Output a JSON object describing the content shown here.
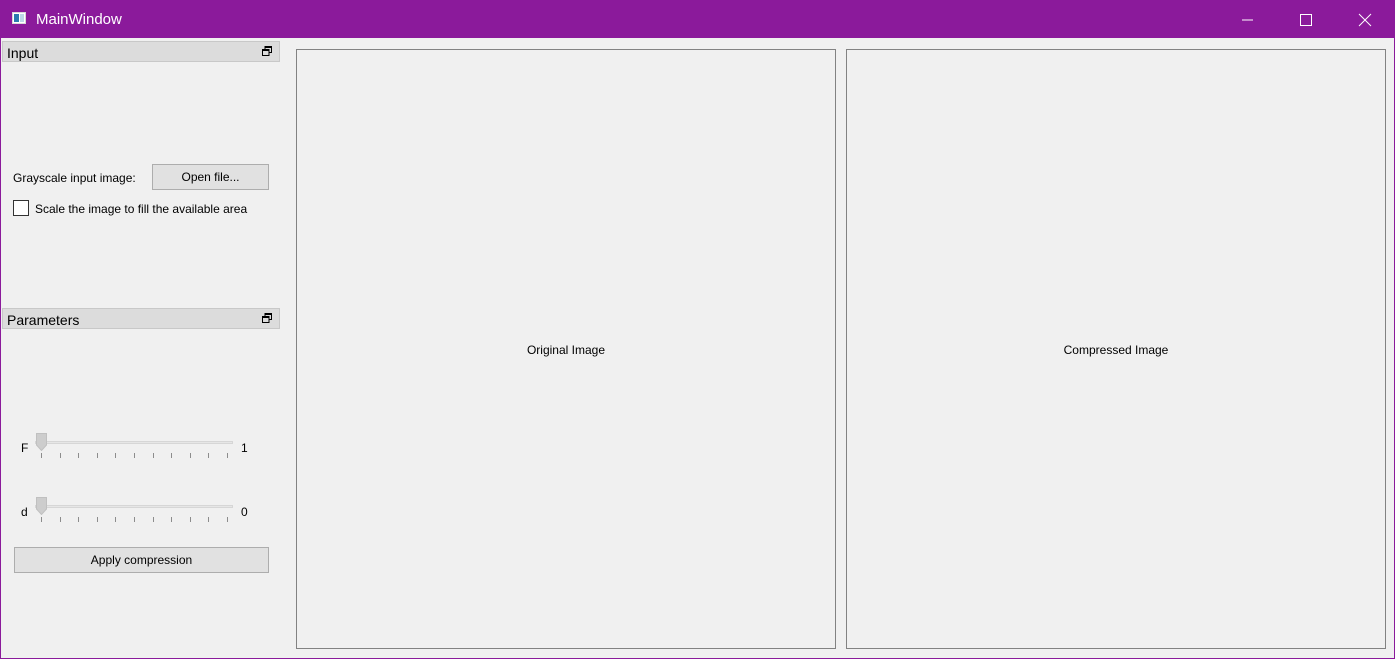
{
  "window": {
    "title": "MainWindow",
    "accent_color": "#8b1a9b",
    "icons": {
      "app": "app-window-icon",
      "minimize": "minimize-icon",
      "maximize": "maximize-icon",
      "close": "close-icon"
    }
  },
  "input_dock": {
    "title": "Input",
    "float_icon": "float-dock-icon",
    "image_label": "Grayscale input image:",
    "open_button": "Open file...",
    "scale_checkbox": {
      "label": "Scale the image to fill the available area",
      "checked": false
    }
  },
  "parameters_dock": {
    "title": "Parameters",
    "float_icon": "float-dock-icon",
    "sliders": [
      {
        "name": "F",
        "value": "1",
        "position": 0.0,
        "tick_count": 11
      },
      {
        "name": "d",
        "value": "0",
        "position": 0.0,
        "tick_count": 11
      }
    ],
    "apply_button": "Apply compression"
  },
  "panels": {
    "original": "Original Image",
    "compressed": "Compressed Image"
  }
}
